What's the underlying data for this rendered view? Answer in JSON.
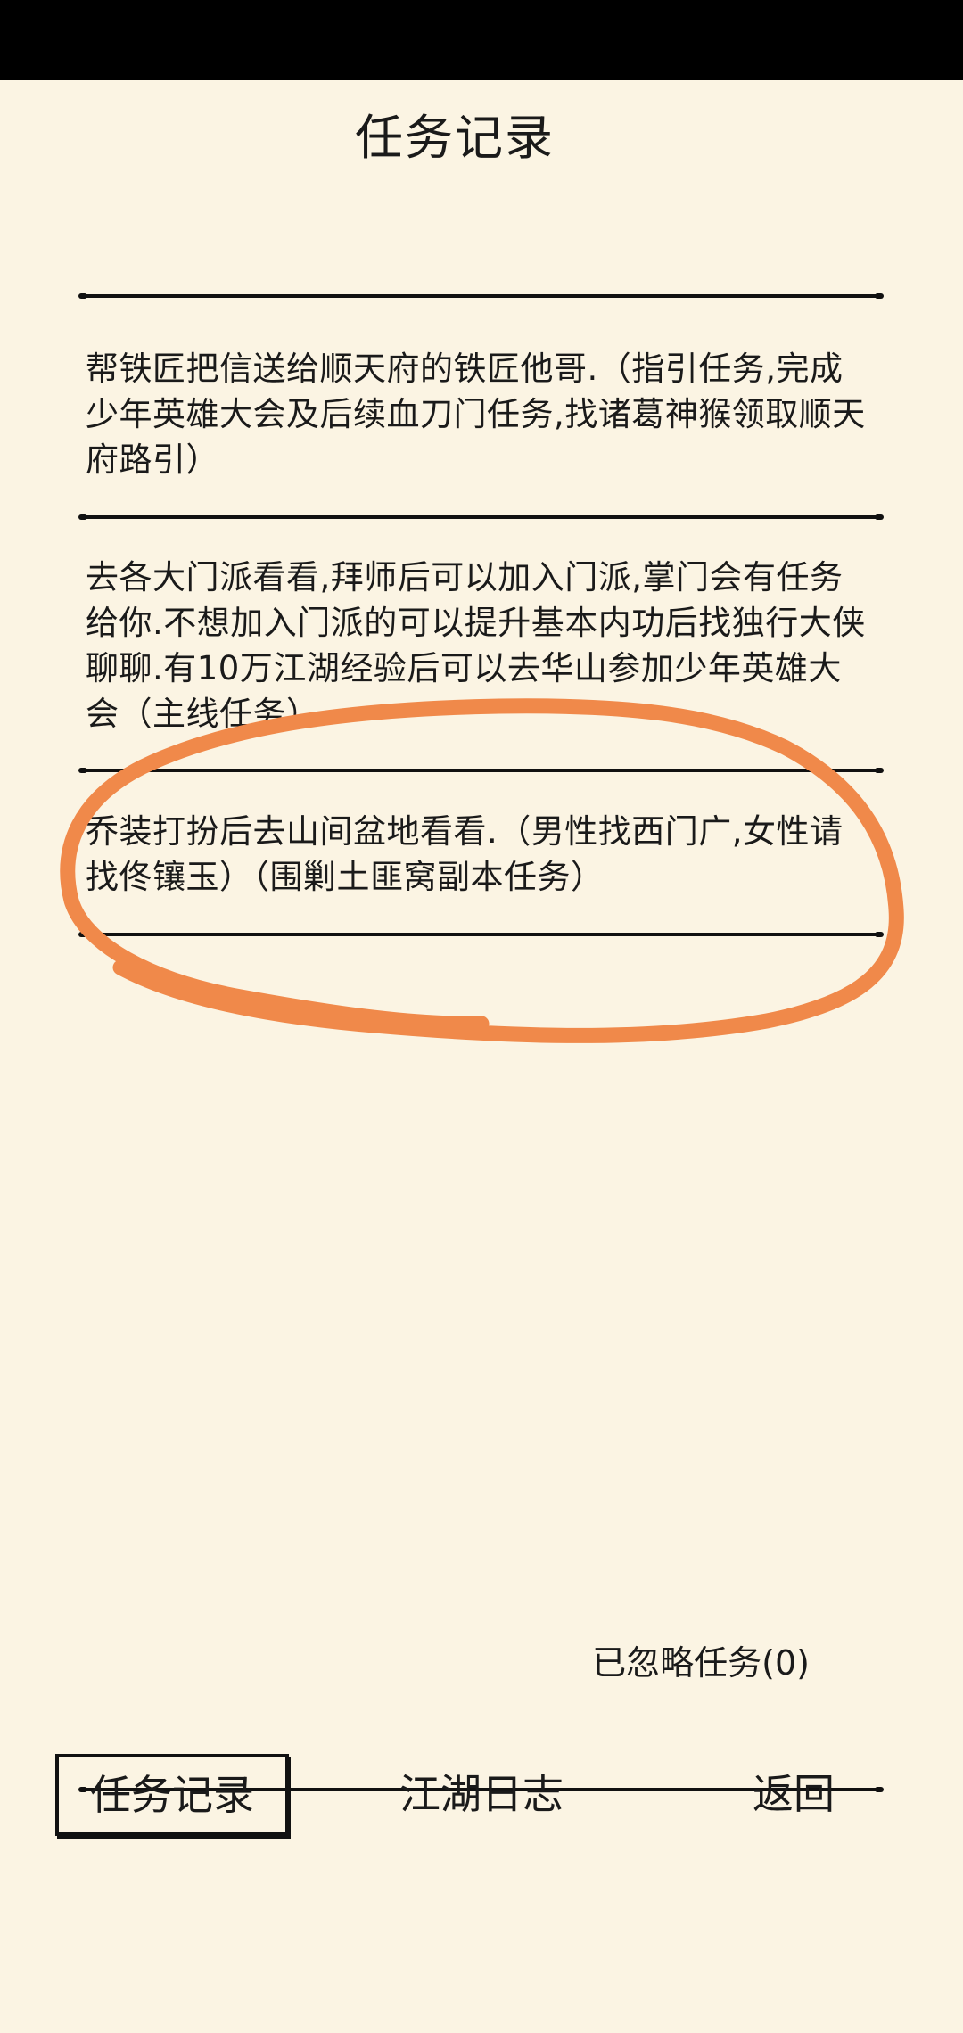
{
  "screen": {
    "title": "任务记录"
  },
  "quests": [
    {
      "text": "帮铁匠把信送给顺天府的铁匠他哥.（指引任务,完成少年英雄大会及后续血刀门任务,找诸葛神猴领取顺天府路引）"
    },
    {
      "text": "去各大门派看看,拜师后可以加入门派,掌门会有任务给你.不想加入门派的可以提升基本内功后找独行大侠聊聊.有10万江湖经验后可以去华山参加少年英雄大会（主线任务）"
    },
    {
      "text": "乔装打扮后去山间盆地看看.（男性找西门广,女性请找佟镶玉）（围剿土匪窝副本任务）"
    }
  ],
  "ignored_label": "已忽略任务(0)",
  "tabs": {
    "records": "任务记录",
    "journal": "江湖日志",
    "back": "返回"
  },
  "colors": {
    "background": "#fbf4e3",
    "ink": "#1a1a1a",
    "annotation": "#f0894a"
  }
}
